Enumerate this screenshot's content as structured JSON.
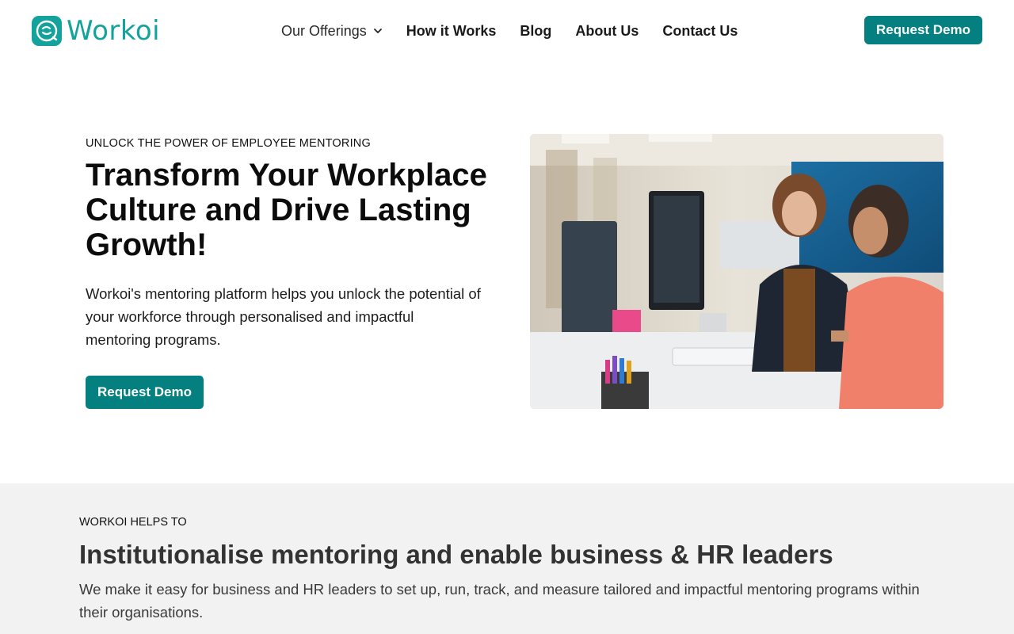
{
  "brand": {
    "name": "Workoi",
    "color": "#14a39c",
    "logo_icon": "workoi-logo-icon"
  },
  "nav": {
    "items": [
      {
        "label": "Our Offerings",
        "has_dropdown": true
      },
      {
        "label": "How it Works"
      },
      {
        "label": "Blog"
      },
      {
        "label": "About Us"
      },
      {
        "label": "Contact Us"
      }
    ],
    "cta_label": "Request Demo"
  },
  "hero": {
    "eyebrow": "UNLOCK THE POWER OF EMPLOYEE MENTORING",
    "title": "Transform Your Workplace Culture and Drive Lasting Growth!",
    "description": "Workoi's mentoring platform helps you unlock the potential of your workforce through personalised and impactful mentoring programs.",
    "cta_label": "Request Demo"
  },
  "section2": {
    "eyebrow": "WORKOI HELPS TO",
    "title": "Institutionalise mentoring and enable business & HR leaders",
    "description": "We make it easy for business and HR leaders to set up, run, track, and measure tailored and impactful mentoring programs within their organisations."
  },
  "colors": {
    "accent": "#03807f",
    "section_bg": "#f2f2f2"
  }
}
